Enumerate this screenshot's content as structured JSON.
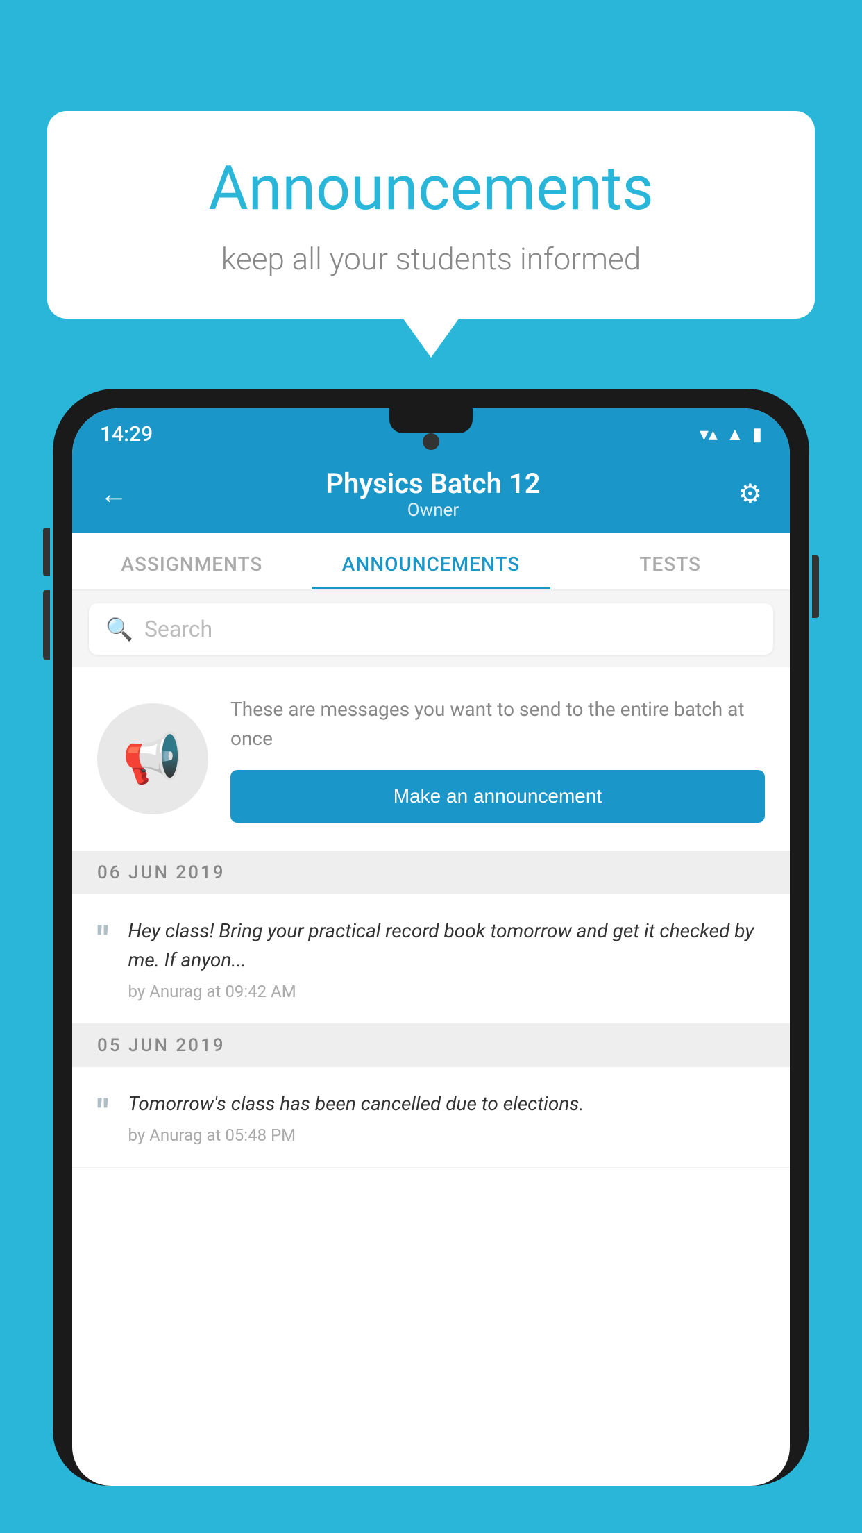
{
  "header": {
    "title": "Announcements",
    "subtitle": "keep all your students informed"
  },
  "status_bar": {
    "time": "14:29",
    "wifi": "▼",
    "signal": "▲",
    "battery": "▮"
  },
  "app_bar": {
    "title": "Physics Batch 12",
    "subtitle": "Owner",
    "back_label": "←",
    "settings_label": "⚙"
  },
  "tabs": [
    {
      "label": "ASSIGNMENTS",
      "active": false
    },
    {
      "label": "ANNOUNCEMENTS",
      "active": true
    },
    {
      "label": "TESTS",
      "active": false
    }
  ],
  "search": {
    "placeholder": "Search"
  },
  "announcement_prompt": {
    "description": "These are messages you want to send to the entire batch at once",
    "button_label": "Make an announcement"
  },
  "date_groups": [
    {
      "date": "06  JUN  2019",
      "announcements": [
        {
          "text": "Hey class! Bring your practical record book tomorrow and get it checked by me. If anyon...",
          "meta": "by Anurag at 09:42 AM"
        }
      ]
    },
    {
      "date": "05  JUN  2019",
      "announcements": [
        {
          "text": "Tomorrow's class has been cancelled due to elections.",
          "meta": "by Anurag at 05:48 PM"
        }
      ]
    }
  ]
}
